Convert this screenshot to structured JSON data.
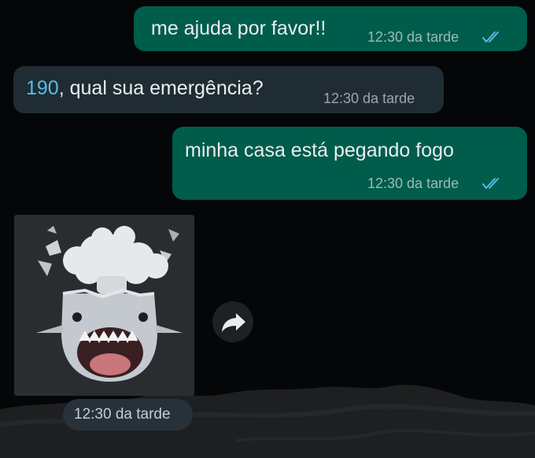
{
  "messages": [
    {
      "direction": "outgoing",
      "text": "me ajuda por favor!!",
      "time": "12:30 da tarde",
      "status": "read"
    },
    {
      "direction": "incoming",
      "link": "190",
      "text": ", qual sua emergência?",
      "time": "12:30 da tarde"
    },
    {
      "direction": "outgoing",
      "text": "minha casa está pegando fogo",
      "time": "12:30 da tarde",
      "status": "read"
    },
    {
      "direction": "incoming",
      "type": "sticker",
      "sticker_icon": "exploding-head-shark-icon",
      "time": "12:30 da tarde"
    }
  ],
  "forward_icon": "forward-arrow-icon",
  "colors": {
    "background": "#050607",
    "outgoing_bubble": "#005c4b",
    "incoming_bubble": "#202c33",
    "read_ticks": "#53bdeb",
    "link": "#53bdeb"
  }
}
